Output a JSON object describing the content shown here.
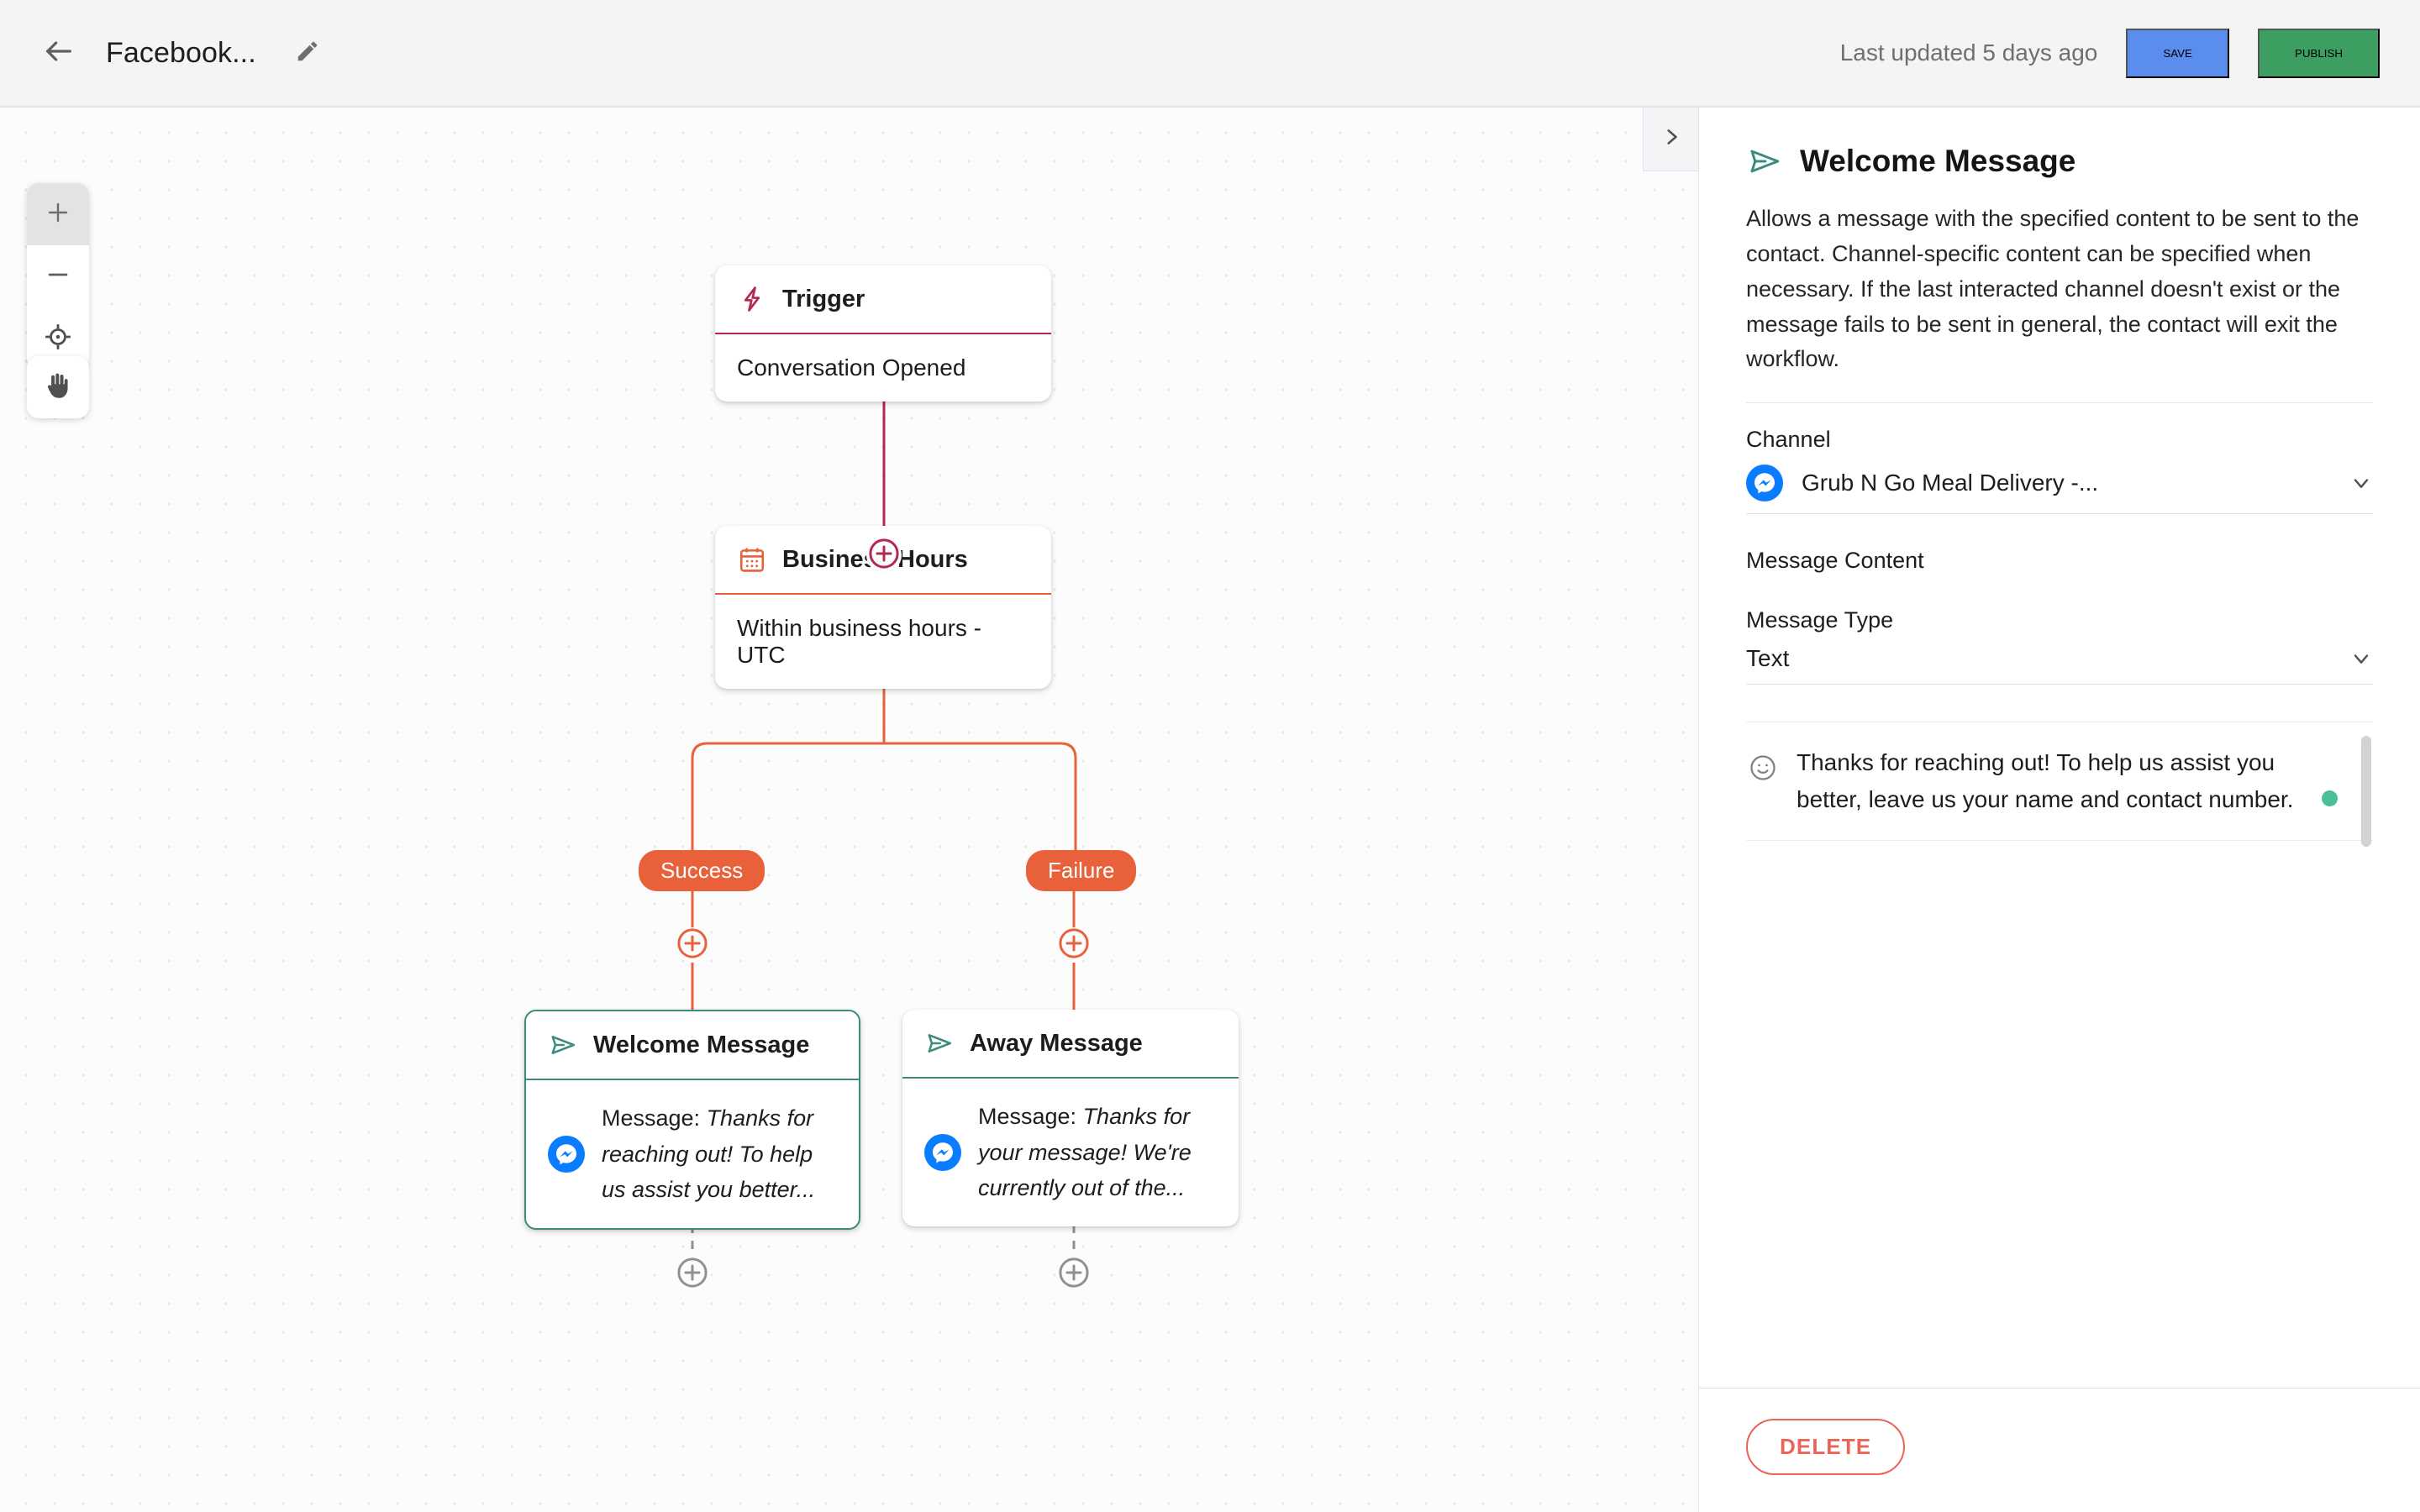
{
  "topbar": {
    "back_icon": "arrow-left-icon",
    "workflow_title": "Facebook...",
    "edit_icon": "pencil-icon",
    "last_updated": "Last updated 5 days ago",
    "save_label": "SAVE",
    "publish_label": "PUBLISH",
    "save_color": "#5b8def",
    "publish_color": "#3d9e61"
  },
  "canvas": {
    "zoom_in_icon": "plus-icon",
    "zoom_out_icon": "minus-icon",
    "recenter_icon": "crosshair-icon",
    "pan_icon": "hand-icon",
    "panel_toggle_icon": "chevron-right-icon",
    "nodes": [
      {
        "id": "trigger",
        "icon": "lightning-bolt-icon",
        "title": "Trigger",
        "body": "Conversation Opened",
        "accent": "#b2284f",
        "selected": false
      },
      {
        "id": "business-hours",
        "icon": "calendar-icon",
        "title": "Business Hours",
        "body": "Within business hours - UTC",
        "accent": "#e8613a",
        "selected": false
      },
      {
        "id": "welcome-message",
        "icon": "send-icon",
        "title": "Welcome Message",
        "body_prefix": "Message: ",
        "body_italic": "Thanks for reaching out! To help us assist you better...",
        "channel_icon": "messenger-icon",
        "accent": "#3d8b7d",
        "selected": true
      },
      {
        "id": "away-message",
        "icon": "send-icon",
        "title": "Away Message",
        "body_prefix": "Message: ",
        "body_italic": "Thanks for your message! We're currently out of the...",
        "channel_icon": "messenger-icon",
        "accent": "#3d8b7d",
        "selected": false
      }
    ],
    "branches": [
      {
        "id": "success",
        "label": "Success",
        "color": "#e8613a"
      },
      {
        "id": "failure",
        "label": "Failure",
        "color": "#e8613a"
      }
    ],
    "add_node_icon": "plus-circle-icon"
  },
  "panel": {
    "title_icon": "send-icon",
    "title": "Welcome Message",
    "description": "Allows a message with the specified content to be sent to the contact. Channel-specific content can be specified when necessary. If the last interacted channel doesn't exist or the message fails to be sent in general, the contact will exit the workflow.",
    "channel_label": "Channel",
    "channel_value": "Grub N Go Meal Delivery -...",
    "channel_icon": "messenger-icon",
    "channel_chevron": "chevron-down-icon",
    "message_content_label": "Message Content",
    "message_type_label": "Message Type",
    "message_type_value": "Text",
    "message_type_chevron": "chevron-down-icon",
    "emoji_icon": "smiley-icon",
    "message_text": "Thanks for reaching out! To help us assist you better, leave us your name and contact number.",
    "status_dot_color": "#4bbf96",
    "delete_label": "DELETE",
    "delete_color": "#ea6457"
  }
}
